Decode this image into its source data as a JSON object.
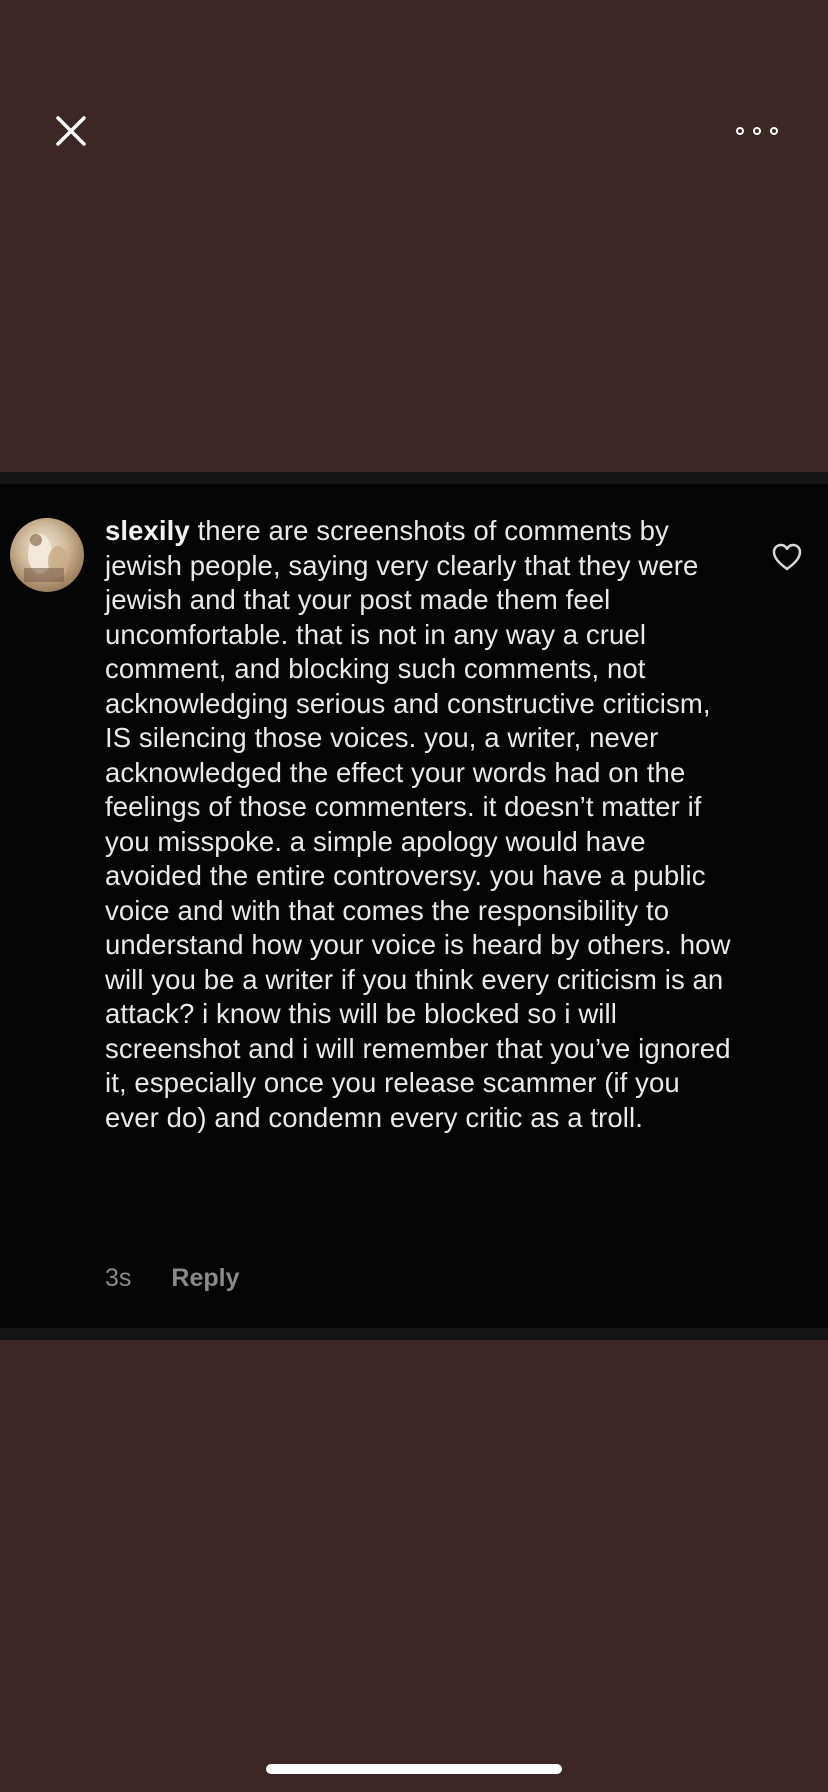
{
  "toolbar": {
    "close_icon": "close-icon",
    "more_icon": "more-options-icon"
  },
  "comment": {
    "username": "slexily",
    "text": "there are screenshots of comments by jewish people, saying very clearly that they were jewish and that your post made them feel uncomfortable.  that is not in any way a cruel comment, and blocking such comments, not acknowledging serious and constructive criticism, IS silencing those voices. you, a writer, never acknowledged the effect your words had on the feelings of those commenters. it doesn’t matter if you misspoke. a simple apology would have avoided the entire controversy. you have a public voice and with that comes the responsibility to understand how your voice is heard by others. how will you be a writer if you think every criticism is an attack? i know this will be blocked so i will screenshot and i will remember that you’ve ignored it, especially once you release scammer (if you ever do) and condemn every critic as a troll.",
    "timestamp": "3s",
    "reply_label": "Reply",
    "like_icon": "heart-icon"
  },
  "colors": {
    "background": "#3c2727",
    "panel": "#050505",
    "text": "#e9e9e9",
    "meta": "#8a8a8a"
  }
}
